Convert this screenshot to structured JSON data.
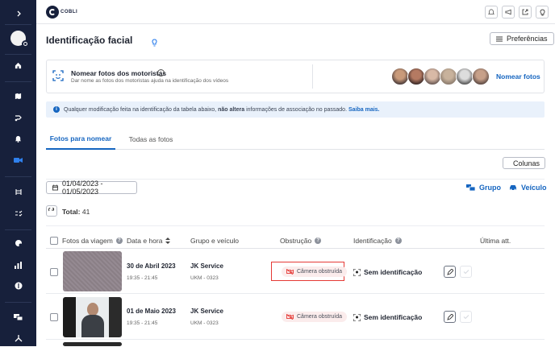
{
  "app": {
    "logo_text": "COBLI"
  },
  "page": {
    "title": "Identificação facial",
    "preferences_label": "Preferências"
  },
  "name_card": {
    "title": "Nomear fotos dos motoristas",
    "subtitle": "Dar nome as fotos dos motoristas ajuda na identificação dos vídeos",
    "action": "Nomear fotos"
  },
  "info_banner": {
    "text_prefix": "Qualquer modificação feita na identificação da tabela abaixo, ",
    "text_bold": "não altera",
    "text_suffix": " informações de associação no passado. ",
    "link": "Saiba mais."
  },
  "tabs": [
    {
      "label": "Fotos para nomear",
      "active": true
    },
    {
      "label": "Todas as fotos",
      "active": false
    }
  ],
  "toolbar": {
    "columns_label": "Colunas",
    "date_range": "01/04/2023 - 01/05/2023",
    "group_label": "Grupo",
    "vehicle_label": "Veículo",
    "total_label": "Total:",
    "total_value": "41"
  },
  "table": {
    "headers": [
      "Fotos da viagem",
      "Data e hora",
      "Grupo e veículo",
      "Obstrução",
      "Identificação",
      "Última att."
    ],
    "rows": [
      {
        "date": "30 de Abril 2023",
        "time": "19:35 - 21:45",
        "group": "JK Service",
        "vehicle": "UKM - 0323",
        "obstruction": "Câmera obstruída",
        "identification": "Sem identificação",
        "highlighted": true
      },
      {
        "date": "01 de Maio 2023",
        "time": "19:35 - 21:45",
        "group": "JK Service",
        "vehicle": "UKM - 0323",
        "obstruction": "Câmera obstruída",
        "identification": "Sem identificação",
        "highlighted": false
      }
    ]
  },
  "colors": {
    "sidebar": "#17203b",
    "accent": "#1565c0",
    "highlight": "#e53935"
  }
}
